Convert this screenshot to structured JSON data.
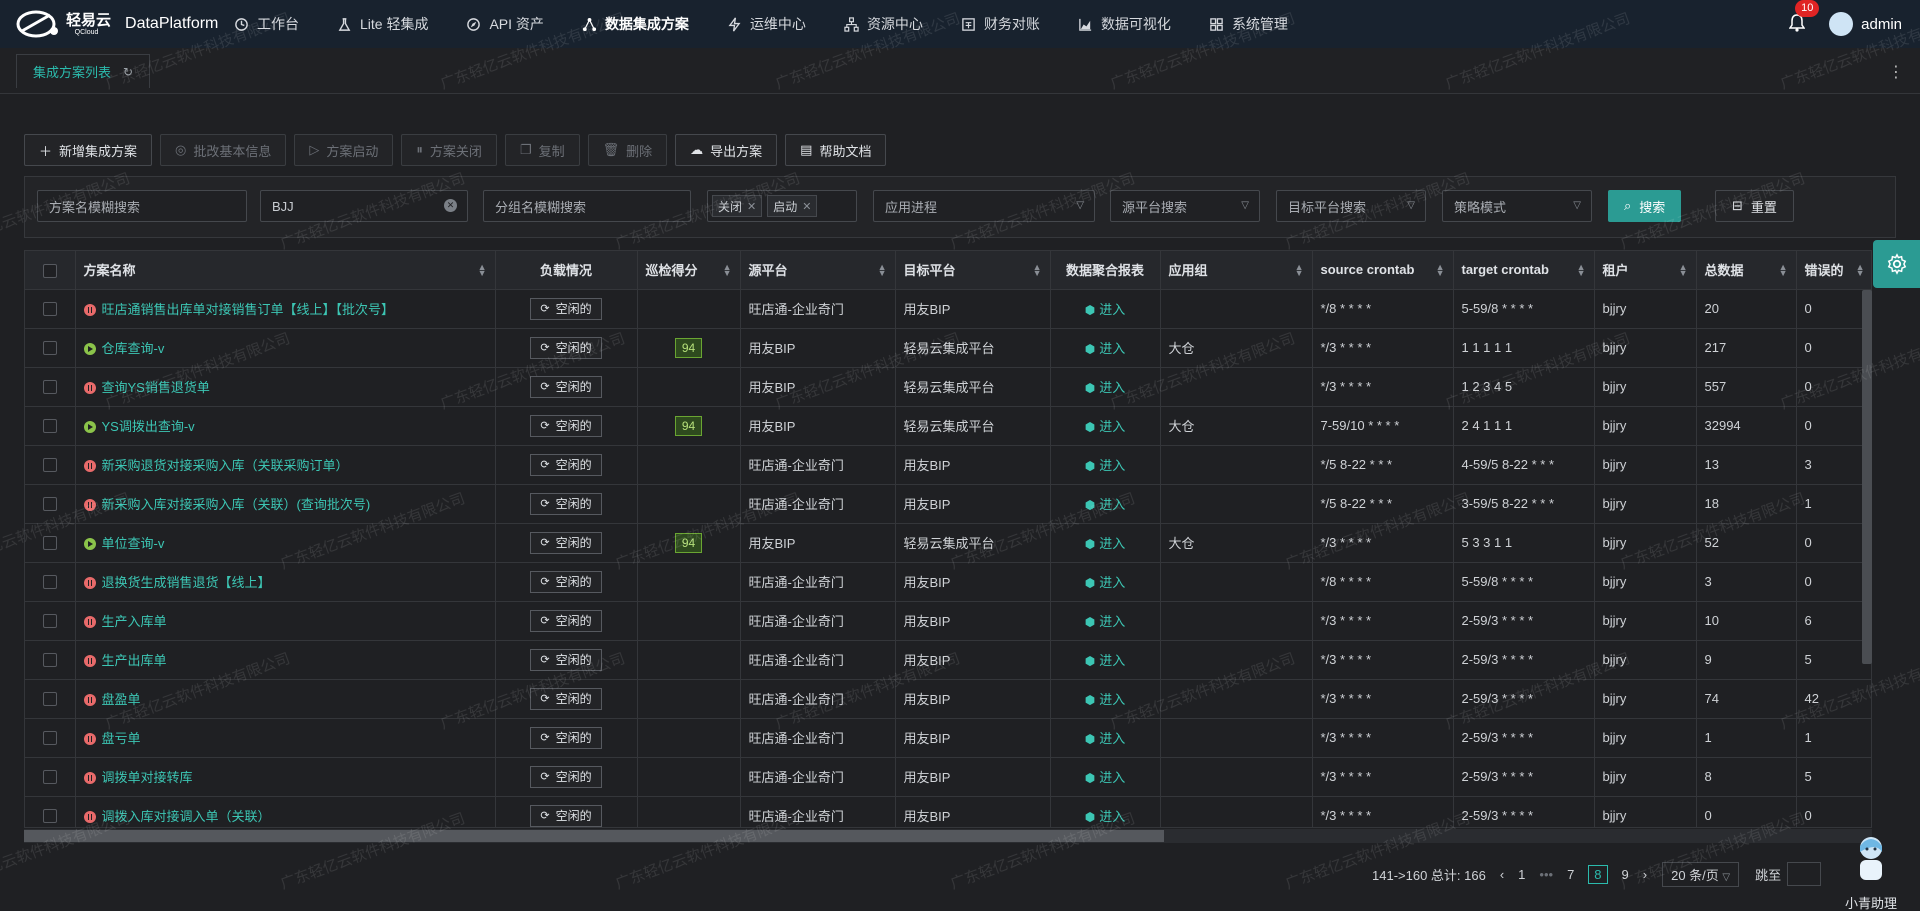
{
  "brand": {
    "name_cn": "轻易云",
    "name_en": "QCloud",
    "app": "DataPlatform"
  },
  "nav": [
    {
      "label": "工作台",
      "icon": "clock-icon"
    },
    {
      "label": "Lite 轻集成",
      "icon": "flask-icon"
    },
    {
      "label": "API 资产",
      "icon": "compass-icon"
    },
    {
      "label": "数据集成方案",
      "icon": "share-nodes-icon",
      "active": true
    },
    {
      "label": "运维中心",
      "icon": "lightning-icon"
    },
    {
      "label": "资源中心",
      "icon": "hierarchy-icon"
    },
    {
      "label": "财务对账",
      "icon": "ledger-icon"
    },
    {
      "label": "数据可视化",
      "icon": "area-chart-icon"
    },
    {
      "label": "系统管理",
      "icon": "grid-icon"
    }
  ],
  "user": {
    "notifications": "10",
    "name": "admin"
  },
  "tab": {
    "label": "集成方案列表"
  },
  "toolbar": {
    "add": "新增集成方案",
    "batch_edit": "批改基本信息",
    "start": "方案启动",
    "close": "方案关闭",
    "copy": "复制",
    "delete": "删除",
    "export": "导出方案",
    "help": "帮助文档"
  },
  "filters": {
    "name_placeholder": "方案名模糊搜索",
    "keyword_value": "BJJ",
    "group_placeholder": "分组名模糊搜索",
    "status_tags": [
      "关闭",
      "启动"
    ],
    "process_placeholder": "应用进程",
    "source_placeholder": "源平台搜索",
    "target_placeholder": "目标平台搜索",
    "strategy_placeholder": "策略模式",
    "search": "搜索",
    "reset": "重置"
  },
  "table": {
    "columns": [
      "方案名称",
      "负载情况",
      "巡检得分",
      "源平台",
      "目标平台",
      "数据聚合报表",
      "应用组",
      "source crontab",
      "target crontab",
      "租户",
      "总数据",
      "错误的"
    ],
    "load_label": "空闲的",
    "enter_label": "进入",
    "rows": [
      {
        "status": "stop",
        "name": "旺店通销售出库单对接销售订单【线上】【批次号】",
        "score": "",
        "source": "旺店通-企业奇门",
        "target": "用友BIP",
        "group": "",
        "src_cron": "*/8 * * * *",
        "tgt_cron": "5-59/8 * * * *",
        "tenant": "bjjry",
        "total": "20",
        "errors": "0"
      },
      {
        "status": "run",
        "name": "仓库查询-v",
        "score": "94",
        "source": "用友BIP",
        "target": "轻易云集成平台",
        "group": "大仓",
        "src_cron": "*/3 * * * *",
        "tgt_cron": "1 1 1 1 1",
        "tenant": "bjjry",
        "total": "217",
        "errors": "0"
      },
      {
        "status": "stop",
        "name": "查询YS销售退货单",
        "score": "",
        "source": "用友BIP",
        "target": "轻易云集成平台",
        "group": "",
        "src_cron": "*/3 * * * *",
        "tgt_cron": "1 2 3 4 5",
        "tenant": "bjjry",
        "total": "557",
        "errors": "0"
      },
      {
        "status": "run",
        "name": "YS调拨出查询-v",
        "score": "94",
        "source": "用友BIP",
        "target": "轻易云集成平台",
        "group": "大仓",
        "src_cron": "7-59/10 * * * *",
        "tgt_cron": "2 4 1 1 1",
        "tenant": "bjjry",
        "total": "32994",
        "errors": "0"
      },
      {
        "status": "stop",
        "name": "新采购退货对接采购入库（关联采购订单）",
        "score": "",
        "source": "旺店通-企业奇门",
        "target": "用友BIP",
        "group": "",
        "src_cron": "*/5 8-22 * * *",
        "tgt_cron": "4-59/5 8-22 * * *",
        "tenant": "bjjry",
        "total": "13",
        "errors": "3"
      },
      {
        "status": "stop",
        "name": "新采购入库对接采购入库（关联）(查询批次号)",
        "score": "",
        "source": "旺店通-企业奇门",
        "target": "用友BIP",
        "group": "",
        "src_cron": "*/5 8-22 * * *",
        "tgt_cron": "3-59/5 8-22 * * *",
        "tenant": "bjjry",
        "total": "18",
        "errors": "1"
      },
      {
        "status": "run",
        "name": "单位查询-v",
        "score": "94",
        "source": "用友BIP",
        "target": "轻易云集成平台",
        "group": "大仓",
        "src_cron": "*/3 * * * *",
        "tgt_cron": "5 3 3 1 1",
        "tenant": "bjjry",
        "total": "52",
        "errors": "0"
      },
      {
        "status": "stop",
        "name": "退换货生成销售退货【线上】",
        "score": "",
        "source": "旺店通-企业奇门",
        "target": "用友BIP",
        "group": "",
        "src_cron": "*/8 * * * *",
        "tgt_cron": "5-59/8 * * * *",
        "tenant": "bjjry",
        "total": "3",
        "errors": "0"
      },
      {
        "status": "stop",
        "name": "生产入库单",
        "score": "",
        "source": "旺店通-企业奇门",
        "target": "用友BIP",
        "group": "",
        "src_cron": "*/3 * * * *",
        "tgt_cron": "2-59/3 * * * *",
        "tenant": "bjjry",
        "total": "10",
        "errors": "6"
      },
      {
        "status": "stop",
        "name": "生产出库单",
        "score": "",
        "source": "旺店通-企业奇门",
        "target": "用友BIP",
        "group": "",
        "src_cron": "*/3 * * * *",
        "tgt_cron": "2-59/3 * * * *",
        "tenant": "bjjry",
        "total": "9",
        "errors": "5"
      },
      {
        "status": "stop",
        "name": "盘盈单",
        "score": "",
        "source": "旺店通-企业奇门",
        "target": "用友BIP",
        "group": "",
        "src_cron": "*/3 * * * *",
        "tgt_cron": "2-59/3 * * * *",
        "tenant": "bjjry",
        "total": "74",
        "errors": "42"
      },
      {
        "status": "stop",
        "name": "盘亏单",
        "score": "",
        "source": "旺店通-企业奇门",
        "target": "用友BIP",
        "group": "",
        "src_cron": "*/3 * * * *",
        "tgt_cron": "2-59/3 * * * *",
        "tenant": "bjjry",
        "total": "1",
        "errors": "1"
      },
      {
        "status": "stop",
        "name": "调拨单对接转库",
        "score": "",
        "source": "旺店通-企业奇门",
        "target": "用友BIP",
        "group": "",
        "src_cron": "*/3 * * * *",
        "tgt_cron": "2-59/3 * * * *",
        "tenant": "bjjry",
        "total": "8",
        "errors": "5"
      },
      {
        "status": "stop",
        "name": "调拨入库对接调入单（关联）",
        "score": "",
        "source": "旺店通-企业奇门",
        "target": "用友BIP",
        "group": "",
        "src_cron": "*/3 * * * *",
        "tgt_cron": "2-59/3 * * * *",
        "tenant": "bjjry",
        "total": "0",
        "errors": "0"
      }
    ]
  },
  "pagination": {
    "summary": "141->160 总计: 166",
    "pages": [
      "1",
      "•••",
      "7",
      "8",
      "9"
    ],
    "current": "8",
    "page_size": "20 条/页",
    "jump_label": "跳至"
  },
  "assistant": {
    "label": "小青助理"
  },
  "watermark": "广东轻亿云软件科技有限公司",
  "colors": {
    "accent": "#2bbbad",
    "primary_btn": "#2b9b93",
    "nav_bg": "#18222e",
    "stop": "#e86a6a",
    "run": "#8bc34a"
  }
}
